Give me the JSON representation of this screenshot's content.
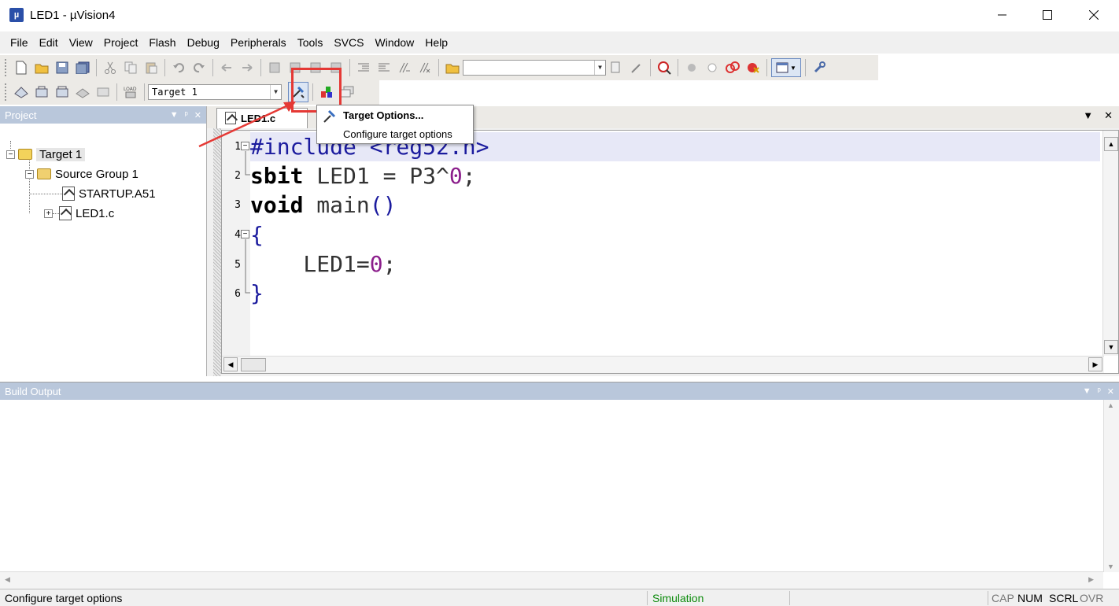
{
  "window": {
    "title": "LED1  - µVision4"
  },
  "menu": [
    "File",
    "Edit",
    "View",
    "Project",
    "Flash",
    "Debug",
    "Peripherals",
    "Tools",
    "SVCS",
    "Window",
    "Help"
  ],
  "toolbar": {
    "target_select": "Target 1"
  },
  "tooltip": {
    "title": "Target Options...",
    "description": "Configure target options"
  },
  "project_panel": {
    "title": "Project",
    "tree": [
      {
        "label": "Target 1",
        "level": 0,
        "expanded": true
      },
      {
        "label": "Source Group 1",
        "level": 1,
        "expanded": true
      },
      {
        "label": "STARTUP.A51",
        "level": 2
      },
      {
        "label": "LED1.c",
        "level": 2,
        "expanded": false
      }
    ]
  },
  "editor": {
    "tab": "LED1.c",
    "lines": [
      {
        "num": "1",
        "text": "#include <reg52.h>"
      },
      {
        "num": "2",
        "text": "sbit LED1 = P3^0;"
      },
      {
        "num": "3",
        "text": "void main()"
      },
      {
        "num": "4",
        "text": "{"
      },
      {
        "num": "5",
        "text": "    LED1=0;"
      },
      {
        "num": "6",
        "text": "}"
      }
    ]
  },
  "build_output": {
    "title": "Build Output"
  },
  "status": {
    "message": "Configure target options",
    "mode": "Simulation",
    "mode_color": "#0a8a0a",
    "indicators": [
      "CAP",
      "NUM",
      "SCRL",
      "OVR"
    ]
  },
  "colors": {
    "highlight": "#e53935",
    "panel_header": "#b9c7db"
  }
}
